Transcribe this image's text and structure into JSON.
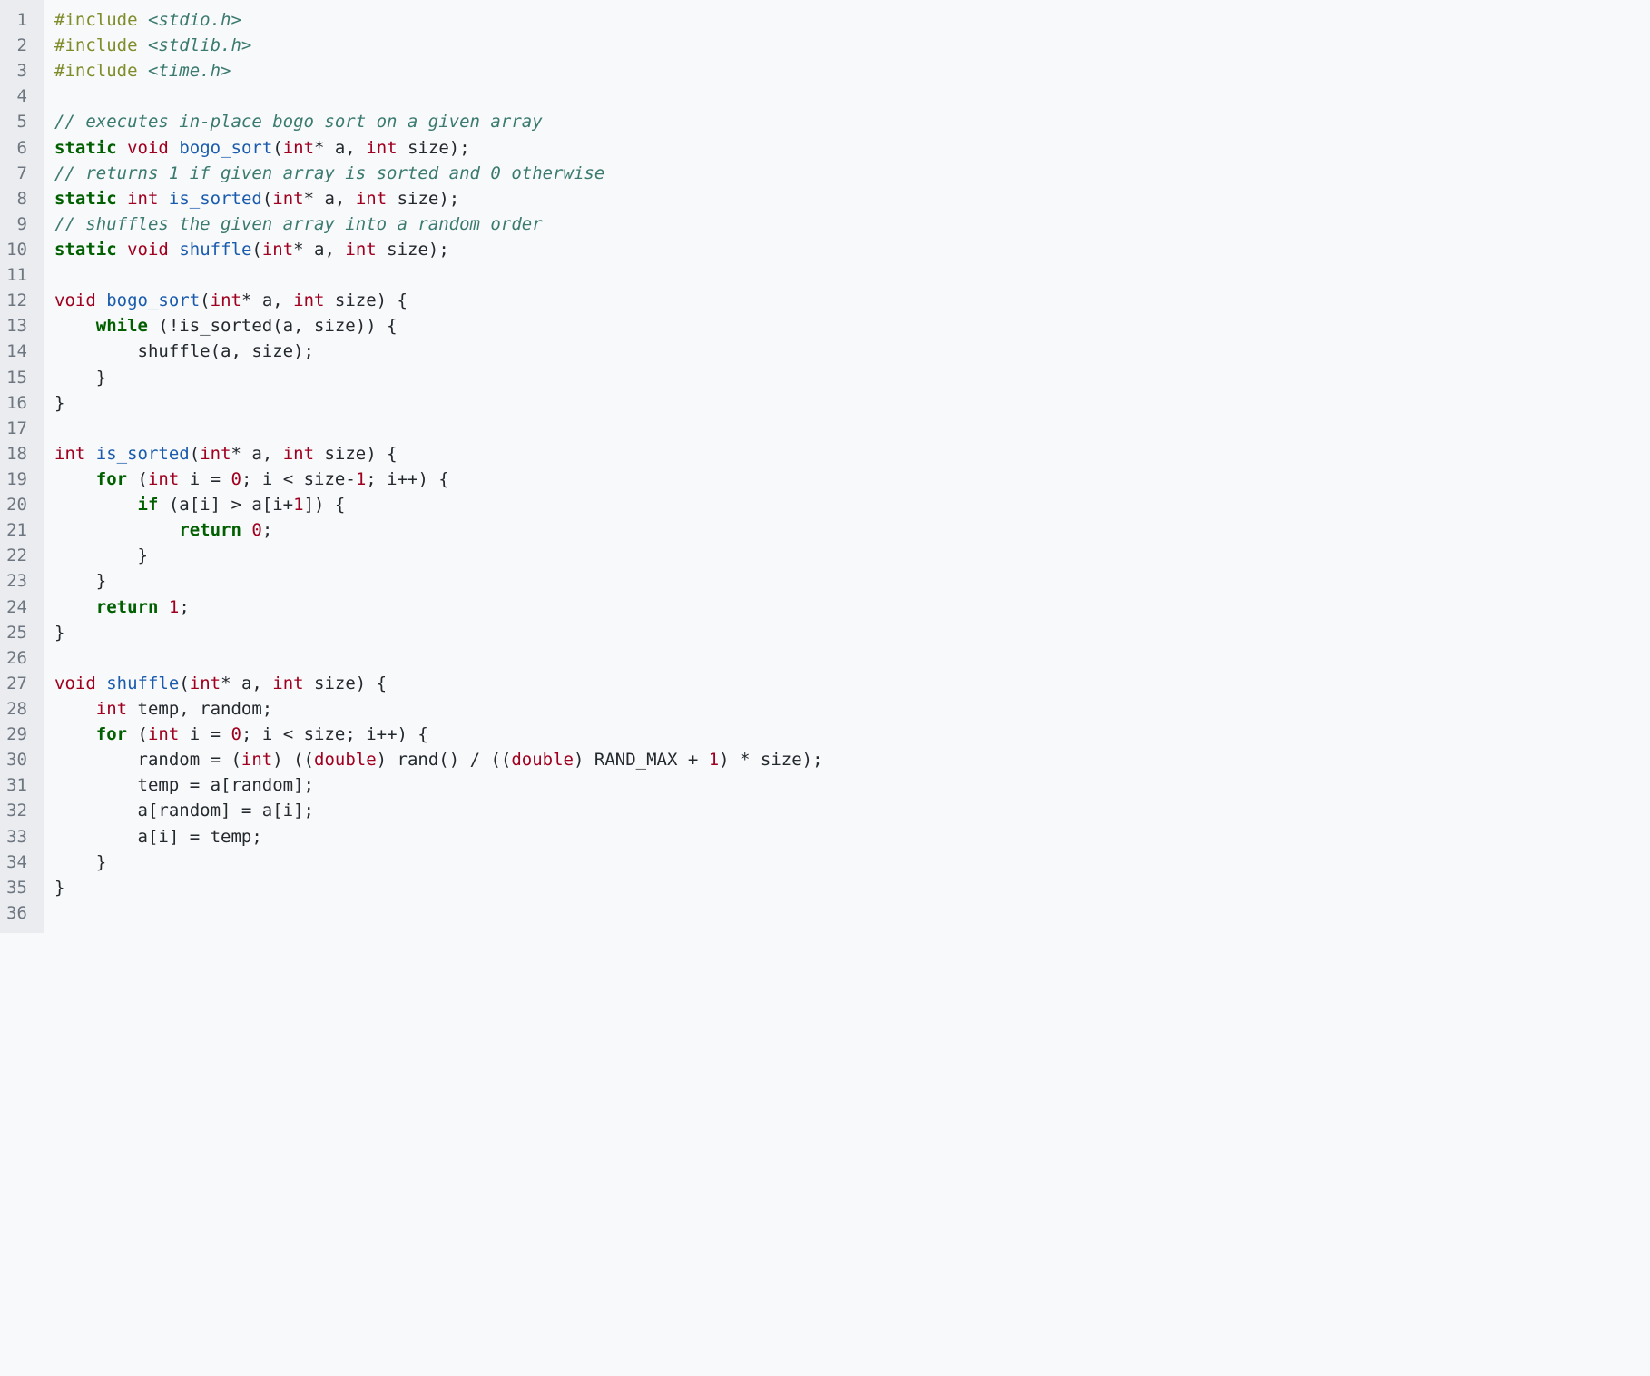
{
  "lines": [
    [
      {
        "t": "#include ",
        "c": "pp"
      },
      {
        "t": "<stdio.h>",
        "c": "inc"
      }
    ],
    [
      {
        "t": "#include ",
        "c": "pp"
      },
      {
        "t": "<stdlib.h>",
        "c": "inc"
      }
    ],
    [
      {
        "t": "#include ",
        "c": "pp"
      },
      {
        "t": "<time.h>",
        "c": "inc"
      }
    ],
    [],
    [
      {
        "t": "// executes in-place bogo sort on a given array",
        "c": "comment"
      }
    ],
    [
      {
        "t": "static",
        "c": "kw"
      },
      {
        "t": " ",
        "c": ""
      },
      {
        "t": "void",
        "c": "type"
      },
      {
        "t": " ",
        "c": ""
      },
      {
        "t": "bogo_sort",
        "c": "func"
      },
      {
        "t": "(",
        "c": ""
      },
      {
        "t": "int",
        "c": "type"
      },
      {
        "t": "* a, ",
        "c": ""
      },
      {
        "t": "int",
        "c": "type"
      },
      {
        "t": " size);",
        "c": ""
      }
    ],
    [
      {
        "t": "// returns 1 if given array is sorted and 0 otherwise",
        "c": "comment"
      }
    ],
    [
      {
        "t": "static",
        "c": "kw"
      },
      {
        "t": " ",
        "c": ""
      },
      {
        "t": "int",
        "c": "type"
      },
      {
        "t": " ",
        "c": ""
      },
      {
        "t": "is_sorted",
        "c": "func"
      },
      {
        "t": "(",
        "c": ""
      },
      {
        "t": "int",
        "c": "type"
      },
      {
        "t": "* a, ",
        "c": ""
      },
      {
        "t": "int",
        "c": "type"
      },
      {
        "t": " size);",
        "c": ""
      }
    ],
    [
      {
        "t": "// shuffles the given array into a random order",
        "c": "comment"
      }
    ],
    [
      {
        "t": "static",
        "c": "kw"
      },
      {
        "t": " ",
        "c": ""
      },
      {
        "t": "void",
        "c": "type"
      },
      {
        "t": " ",
        "c": ""
      },
      {
        "t": "shuffle",
        "c": "func"
      },
      {
        "t": "(",
        "c": ""
      },
      {
        "t": "int",
        "c": "type"
      },
      {
        "t": "* a, ",
        "c": ""
      },
      {
        "t": "int",
        "c": "type"
      },
      {
        "t": " size);",
        "c": ""
      }
    ],
    [],
    [
      {
        "t": "void",
        "c": "type"
      },
      {
        "t": " ",
        "c": ""
      },
      {
        "t": "bogo_sort",
        "c": "func"
      },
      {
        "t": "(",
        "c": ""
      },
      {
        "t": "int",
        "c": "type"
      },
      {
        "t": "* a, ",
        "c": ""
      },
      {
        "t": "int",
        "c": "type"
      },
      {
        "t": " size) {",
        "c": ""
      }
    ],
    [
      {
        "t": "    ",
        "c": ""
      },
      {
        "t": "while",
        "c": "kw"
      },
      {
        "t": " (!is_sorted(a, size)) {",
        "c": ""
      }
    ],
    [
      {
        "t": "        shuffle(a, size);",
        "c": ""
      }
    ],
    [
      {
        "t": "    }",
        "c": ""
      }
    ],
    [
      {
        "t": "}",
        "c": ""
      }
    ],
    [],
    [
      {
        "t": "int",
        "c": "type"
      },
      {
        "t": " ",
        "c": ""
      },
      {
        "t": "is_sorted",
        "c": "func"
      },
      {
        "t": "(",
        "c": ""
      },
      {
        "t": "int",
        "c": "type"
      },
      {
        "t": "* a, ",
        "c": ""
      },
      {
        "t": "int",
        "c": "type"
      },
      {
        "t": " size) {",
        "c": ""
      }
    ],
    [
      {
        "t": "    ",
        "c": ""
      },
      {
        "t": "for",
        "c": "kw"
      },
      {
        "t": " (",
        "c": ""
      },
      {
        "t": "int",
        "c": "type"
      },
      {
        "t": " i = ",
        "c": ""
      },
      {
        "t": "0",
        "c": "num"
      },
      {
        "t": "; i < size-",
        "c": ""
      },
      {
        "t": "1",
        "c": "num"
      },
      {
        "t": "; i++) {",
        "c": ""
      }
    ],
    [
      {
        "t": "        ",
        "c": ""
      },
      {
        "t": "if",
        "c": "kw"
      },
      {
        "t": " (a[i] > a[i+",
        "c": ""
      },
      {
        "t": "1",
        "c": "num"
      },
      {
        "t": "]) {",
        "c": ""
      }
    ],
    [
      {
        "t": "            ",
        "c": ""
      },
      {
        "t": "return",
        "c": "kw"
      },
      {
        "t": " ",
        "c": ""
      },
      {
        "t": "0",
        "c": "num"
      },
      {
        "t": ";",
        "c": ""
      }
    ],
    [
      {
        "t": "        }",
        "c": ""
      }
    ],
    [
      {
        "t": "    }",
        "c": ""
      }
    ],
    [
      {
        "t": "    ",
        "c": ""
      },
      {
        "t": "return",
        "c": "kw"
      },
      {
        "t": " ",
        "c": ""
      },
      {
        "t": "1",
        "c": "num"
      },
      {
        "t": ";",
        "c": ""
      }
    ],
    [
      {
        "t": "}",
        "c": ""
      }
    ],
    [],
    [
      {
        "t": "void",
        "c": "type"
      },
      {
        "t": " ",
        "c": ""
      },
      {
        "t": "shuffle",
        "c": "func"
      },
      {
        "t": "(",
        "c": ""
      },
      {
        "t": "int",
        "c": "type"
      },
      {
        "t": "* a, ",
        "c": ""
      },
      {
        "t": "int",
        "c": "type"
      },
      {
        "t": " size) {",
        "c": ""
      }
    ],
    [
      {
        "t": "    ",
        "c": ""
      },
      {
        "t": "int",
        "c": "type"
      },
      {
        "t": " temp, random;",
        "c": ""
      }
    ],
    [
      {
        "t": "    ",
        "c": ""
      },
      {
        "t": "for",
        "c": "kw"
      },
      {
        "t": " (",
        "c": ""
      },
      {
        "t": "int",
        "c": "type"
      },
      {
        "t": " i = ",
        "c": ""
      },
      {
        "t": "0",
        "c": "num"
      },
      {
        "t": "; i < size; i++) {",
        "c": ""
      }
    ],
    [
      {
        "t": "        random = (",
        "c": ""
      },
      {
        "t": "int",
        "c": "type"
      },
      {
        "t": ") ((",
        "c": ""
      },
      {
        "t": "double",
        "c": "type"
      },
      {
        "t": ") rand() / ((",
        "c": ""
      },
      {
        "t": "double",
        "c": "type"
      },
      {
        "t": ") RAND_MAX + ",
        "c": ""
      },
      {
        "t": "1",
        "c": "num"
      },
      {
        "t": ") * size);",
        "c": ""
      }
    ],
    [
      {
        "t": "        temp = a[random];",
        "c": ""
      }
    ],
    [
      {
        "t": "        a[random] = a[i];",
        "c": ""
      }
    ],
    [
      {
        "t": "        a[i] = temp;",
        "c": ""
      }
    ],
    [
      {
        "t": "    }",
        "c": ""
      }
    ],
    [
      {
        "t": "}",
        "c": ""
      }
    ],
    []
  ],
  "start_line": 1
}
